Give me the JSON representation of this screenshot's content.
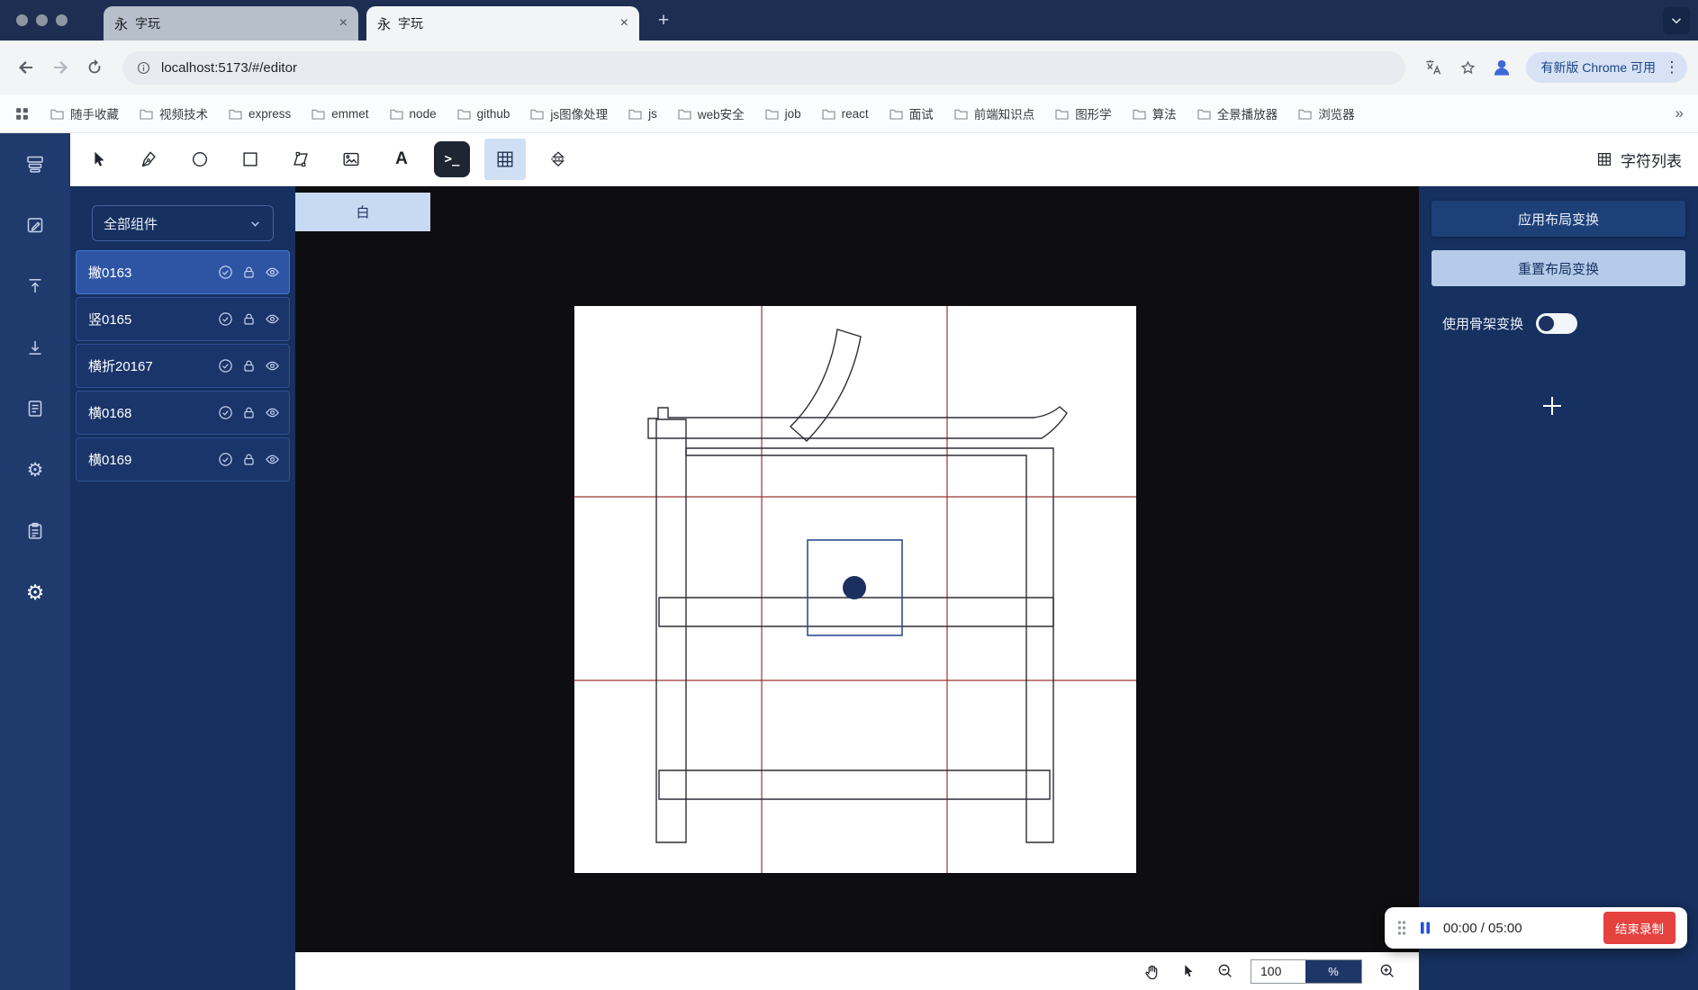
{
  "browser": {
    "tabs": [
      {
        "favicon": "永",
        "title": "字玩"
      },
      {
        "favicon": "永",
        "title": "字玩"
      }
    ],
    "url": "localhost:5173/#/editor",
    "update_chip": "有新版 Chrome 可用",
    "bookmarks": [
      "随手收藏",
      "视频技术",
      "express",
      "emmet",
      "node",
      "github",
      "js图像处理",
      "js",
      "web安全",
      "job",
      "react",
      "面试",
      "前端知识点",
      "图形学",
      "算法",
      "全景播放器",
      "浏览器"
    ]
  },
  "icons": {
    "close_tab": "×",
    "new_tab": "+",
    "kebab": "⋮",
    "more_bookmarks": "»",
    "gear": "⚙",
    "terminal": ">_",
    "text_tool": "A"
  },
  "editor": {
    "toolbar": {
      "char_list": "字符列表"
    },
    "left_panel": {
      "filter": "全部组件",
      "components": [
        {
          "name": "撇0163"
        },
        {
          "name": "竖0165"
        },
        {
          "name": "横折20167"
        },
        {
          "name": "横0168"
        },
        {
          "name": "横0169"
        }
      ]
    },
    "canvas_tab": "白",
    "right_panel": {
      "apply": "应用布局变换",
      "reset": "重置布局变换",
      "skeleton_label": "使用骨架变换"
    },
    "zoom": {
      "value": "100",
      "unit": "%"
    },
    "recorder": {
      "time": "00:00 / 05:00",
      "stop": "结束录制"
    }
  },
  "colors": {
    "titlebar_navy": "#1d2e52",
    "panel_navy": "#16305f",
    "selected_item_blue": "#2e55a4",
    "accent_light_blue": "#cfe0f4",
    "guide_red": "#9c3333",
    "selection_blue": "#2c4f93",
    "record_red": "#e5413f"
  }
}
